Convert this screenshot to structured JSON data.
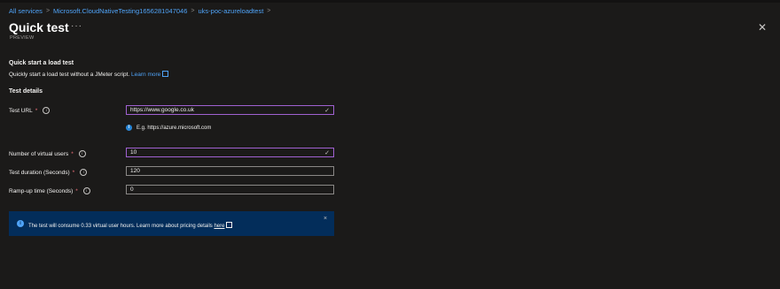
{
  "breadcrumb": {
    "items": [
      "All services",
      "Microsoft.CloudNativeTesting1656281047046",
      "uks-poc-azureloadtest"
    ],
    "sep": ">"
  },
  "header": {
    "title": "Quick test",
    "ellipsis": "···",
    "subtitle": "PREVIEW",
    "close": "✕"
  },
  "quickstart": {
    "title": "Quick start a load test",
    "desc": "Quickly start a load test without a JMeter script.",
    "learn_more": "Learn more"
  },
  "details": {
    "title": "Test details",
    "fields": [
      {
        "label": "Test URL",
        "required": "*",
        "value": "https://www.google.co.uk"
      },
      {
        "label": "Number of virtual users",
        "required": "*",
        "value": "10"
      },
      {
        "label": "Test duration (Seconds)",
        "required": "*",
        "value": "120"
      },
      {
        "label": "Ramp-up time (Seconds)",
        "required": "*",
        "value": "0"
      }
    ],
    "hint": "E.g. https://azure.microsoft.com"
  },
  "banner": {
    "text": "The test will consume 0.33 virtual user hours. Learn more about pricing details",
    "link": "here",
    "close": "×"
  },
  "colors": {
    "background": "#1b1a19",
    "link": "#4fa3f7",
    "focus_border": "#a061d1",
    "banner_bg": "#032d5a",
    "required": "#f1707b"
  }
}
